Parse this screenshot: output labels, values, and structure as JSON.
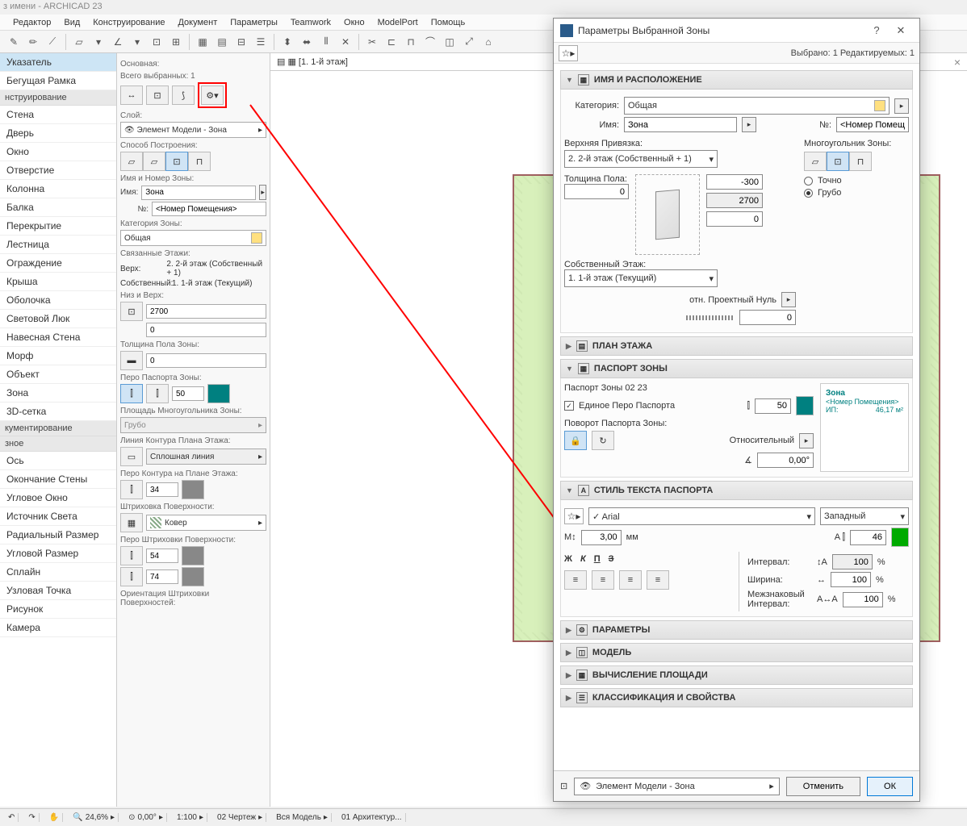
{
  "window": {
    "title": "з имени - ARCHICAD 23"
  },
  "menu": [
    "Редактор",
    "Вид",
    "Конструирование",
    "Документ",
    "Параметры",
    "Teamwork",
    "Окно",
    "ModelPort",
    "Помощь"
  ],
  "floor_tab": "[1. 1-й этаж]",
  "toolbox": {
    "cat_select": [
      "Указатель",
      "Бегущая Рамка"
    ],
    "cat_construct": "нструирование",
    "construct_items": [
      "Стена",
      "Дверь",
      "Окно",
      "Отверстие",
      "Колонна",
      "Балка",
      "Перекрытие",
      "Лестница",
      "Ограждение",
      "Крыша",
      "Оболочка",
      "Световой Люк",
      "Навесная Стена",
      "Морф",
      "Объект",
      "Зона",
      "3D-сетка"
    ],
    "cat_doc": "кументирование",
    "cat_misc": "зное",
    "misc_items": [
      "Ось",
      "Окончание Стены",
      "Угловое Окно",
      "Источник Света",
      "Радиальный Размер",
      "Угловой Размер",
      "Сплайн",
      "Узловая Точка",
      "Рисунок",
      "Камера"
    ]
  },
  "info": {
    "main": "Основная:",
    "selected": "Всего выбранных: 1",
    "layer_label": "Слой:",
    "layer_value": "Элемент Модели - Зона",
    "method": "Способ Построения:",
    "name_section": "Имя и Номер Зоны:",
    "name_label": "Имя:",
    "name_value": "Зона",
    "num_label": "№:",
    "num_value": "<Номер Помещения>",
    "cat_label": "Категория Зоны:",
    "cat_value": "Общая",
    "linked": "Связанные Этажи:",
    "top_label": "Верх:",
    "top_value": "2. 2-й этаж (Собственный + 1)",
    "home_label": "Собственный:",
    "home_value": "1. 1-й этаж (Текущий)",
    "bottom_section": "Низ и Верх:",
    "top_val": "2700",
    "bot_val": "0",
    "floor_thick": "Толщина Пола Зоны:",
    "floor_thick_val": "0",
    "pen_label": "Перо Паспорта Зоны:",
    "pen_val": "50",
    "poly_area": "Площадь Многоугольника Зоны:",
    "poly_val": "Грубо",
    "contour": "Линия Контура Плана Этажа:",
    "contour_val": "Сплошная линия",
    "contour_pen": "Перо Контура на Плане Этажа:",
    "contour_pen_val": "34",
    "fill_label": "Штриховка Поверхности:",
    "fill_val": "Ковер",
    "fill_pen": "Перо Штриховки Поверхности:",
    "fill_pen1": "54",
    "fill_pen2": "74",
    "fill_orient": "Ориентация Штриховки Поверхностей:"
  },
  "dialog": {
    "title": "Параметры Выбранной Зоны",
    "sel_info": "Выбрано: 1 Редактируемых: 1",
    "sec1": "ИМЯ И РАСПОЛОЖЕНИЕ",
    "cat_label": "Категория:",
    "cat_value": "Общая",
    "name_label": "Имя:",
    "name_value": "Зона",
    "num_label": "№:",
    "num_value": "<Номер Помещ",
    "top_link": "Верхняя Привязка:",
    "top_link_val": "2. 2-й этаж (Собственный + 1)",
    "poly_label": "Многоугольник Зоны:",
    "poly_exact": "Точно",
    "poly_rough": "Грубо",
    "val_300": "-300",
    "val_2700": "2700",
    "val_0": "0",
    "floor_thick_label": "Толщина Пола:",
    "home_story": "Собственный Этаж:",
    "home_story_val": "1. 1-й этаж (Текущий)",
    "proj_zero": "отн. Проектный Нуль",
    "sec_floorplan": "ПЛАН ЭТАЖА",
    "sec_stamp": "ПАСПОРТ ЗОНЫ",
    "stamp_name": "Паспорт Зоны 02 23",
    "unified_pen": "Единое Перо Паспорта",
    "pen_50": "50",
    "rotate_stamp": "Поворот Паспорта Зоны:",
    "relative": "Относительный",
    "angle": "0,00°",
    "preview_zone": "Зона",
    "preview_num": "<Номер Помещения>",
    "preview_ip": "ИП:",
    "preview_area": "46,17 м²",
    "sec_text": "СТИЛЬ ТЕКСТА ПАСПОРТА",
    "font": "Arial",
    "script": "Западный",
    "size": "3,00",
    "mm": "мм",
    "pen_text": "46",
    "spacing": "Интервал:",
    "spacing_val": "100",
    "width": "Ширина:",
    "width_val": "100",
    "kerning": "Межзнаковый Интервал:",
    "kerning_val": "100",
    "sec_params": "ПАРАМЕТРЫ",
    "sec_model": "МОДЕЛЬ",
    "sec_area": "ВЫЧИСЛЕНИЕ ПЛОЩАДИ",
    "sec_class": "КЛАССИФИКАЦИЯ И СВОЙСТВА",
    "layer": "Элемент Модели - Зона",
    "cancel": "Отменить",
    "ok": "ОК"
  },
  "status": {
    "zoom": "24,6%",
    "angle": "0,00°",
    "scale": "1:100",
    "view": "02 Чертеж",
    "model": "Вся Модель",
    "arch": "01 Архитектур..."
  }
}
